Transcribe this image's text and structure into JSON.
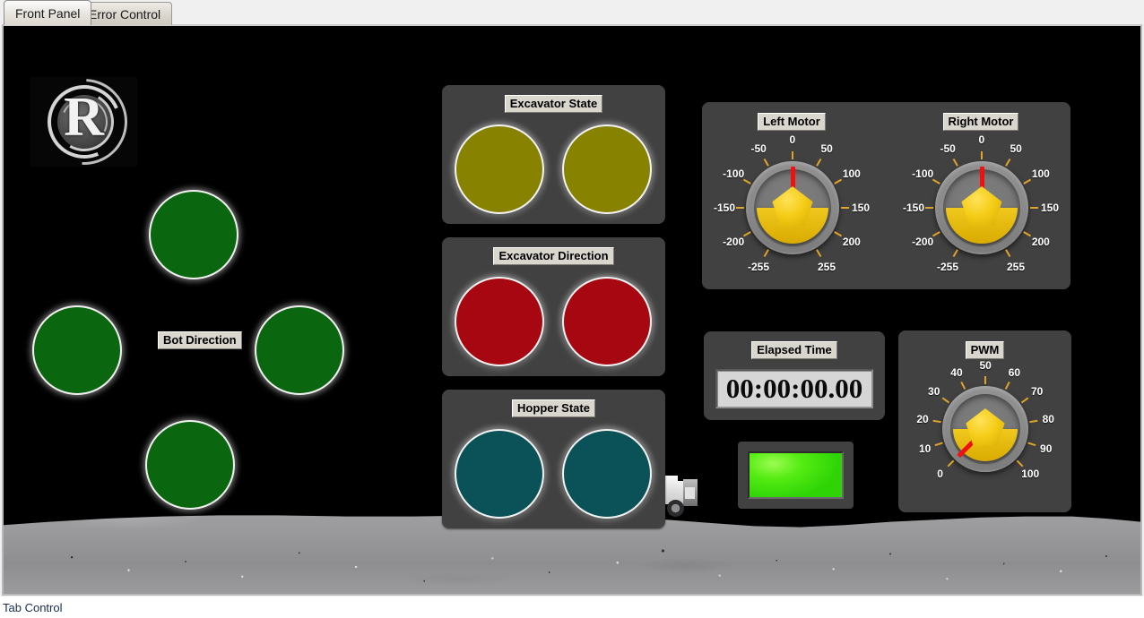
{
  "window": {
    "status_text": "Tab Control"
  },
  "tabs": [
    {
      "label": "Front Panel",
      "active": true
    },
    {
      "label": "Error Control",
      "active": false
    }
  ],
  "logo": {
    "name": "team-logo",
    "glyph": "R"
  },
  "bot_direction": {
    "caption": "Bot Direction",
    "led_color": "#0b6610",
    "leds": [
      {
        "name": "bot-direction-led-up",
        "position": "up",
        "state": "off"
      },
      {
        "name": "bot-direction-led-left",
        "position": "left",
        "state": "off"
      },
      {
        "name": "bot-direction-led-right",
        "position": "right",
        "state": "off"
      },
      {
        "name": "bot-direction-led-down",
        "position": "down",
        "state": "off"
      }
    ]
  },
  "indicator_groups": [
    {
      "caption": "Excavator State",
      "led_color": "#878200",
      "leds": [
        {
          "name": "excavator-state-led-1",
          "state": "off"
        },
        {
          "name": "excavator-state-led-2",
          "state": "off"
        }
      ]
    },
    {
      "caption": "Excavator Direction",
      "led_color": "#a70710",
      "leds": [
        {
          "name": "excavator-direction-led-1",
          "state": "off"
        },
        {
          "name": "excavator-direction-led-2",
          "state": "off"
        }
      ]
    },
    {
      "caption": "Hopper State",
      "led_color": "#0a5257",
      "leds": [
        {
          "name": "hopper-state-led-1",
          "state": "off"
        },
        {
          "name": "hopper-state-led-2",
          "state": "off"
        }
      ]
    }
  ],
  "motor_panel": {
    "knobs": [
      {
        "caption": "Left Motor",
        "value": 0,
        "min": -255,
        "max": 255,
        "tick_labels": [
          "-255",
          "-200",
          "-150",
          "-100",
          "-50",
          "0",
          "50",
          "100",
          "150",
          "200",
          "255"
        ]
      },
      {
        "caption": "Right Motor",
        "value": 0,
        "min": -255,
        "max": 255,
        "tick_labels": [
          "-255",
          "-200",
          "-150",
          "-100",
          "-50",
          "0",
          "50",
          "100",
          "150",
          "200",
          "255"
        ]
      }
    ]
  },
  "pwm_panel": {
    "caption": "PWM",
    "value": 0,
    "min": 0,
    "max": 100,
    "tick_labels": [
      "0",
      "10",
      "20",
      "30",
      "40",
      "50",
      "60",
      "70",
      "80",
      "90",
      "100"
    ]
  },
  "elapsed_time": {
    "caption": "Elapsed Time",
    "value": "00:00:00.00"
  },
  "run_indicator": {
    "name": "run-status-led",
    "state": "on",
    "color": "#4be80f"
  },
  "colors": {
    "panel_bg": "#414141",
    "canvas_bg": "#000000",
    "caption_bg": "#d9d6ce",
    "knob_yellow": "#f5cd18",
    "needle_red": "#ef1111",
    "tick_orange": "#e0a32a"
  }
}
